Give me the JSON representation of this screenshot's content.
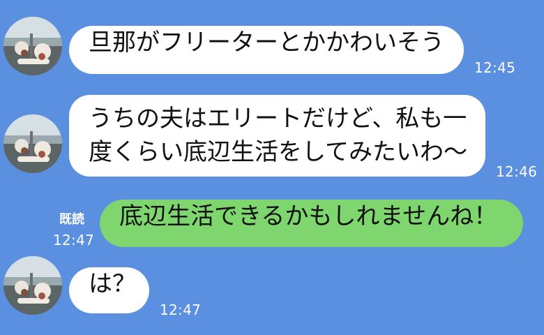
{
  "messages": [
    {
      "side": "left",
      "lines": [
        "旦那がフリーターとかかわいそう"
      ],
      "time": "12:45"
    },
    {
      "side": "left",
      "lines": [
        "うちの夫はエリートだけど、私も一",
        "度くらい底辺生活をしてみたいわ〜"
      ],
      "time": "12:46"
    },
    {
      "side": "right",
      "read": "既読",
      "lines": [
        "底辺生活できるかもしれませんね！"
      ],
      "time": "12:47"
    },
    {
      "side": "left",
      "lines": [
        "は？"
      ],
      "time": "12:47"
    }
  ],
  "colors": {
    "background": "#5b8fe0",
    "bubble_left": "#ffffff",
    "bubble_right": "#7fd66f",
    "timestamp": "#ffffff"
  },
  "icons": {
    "avatar": "avatar-photo"
  }
}
